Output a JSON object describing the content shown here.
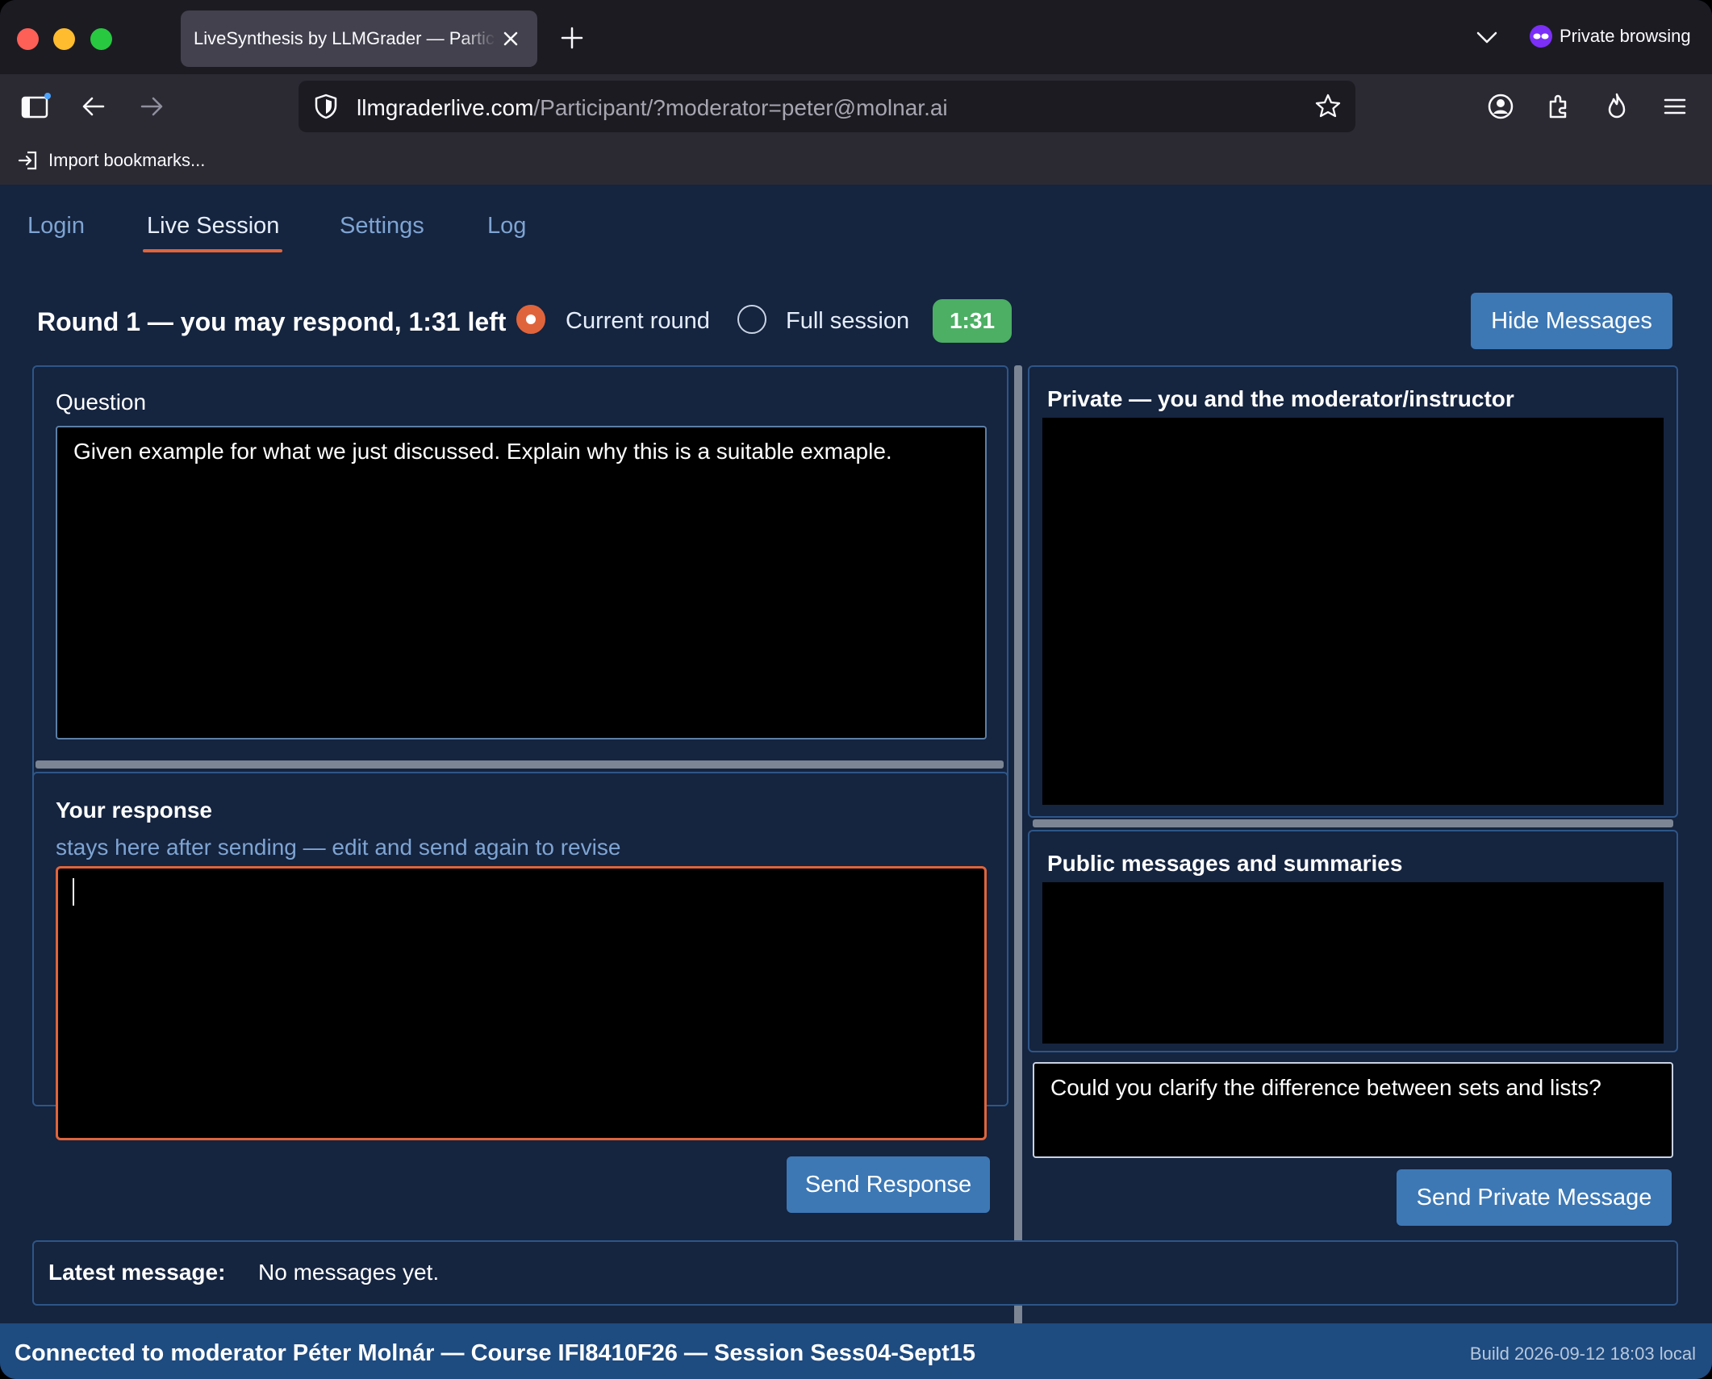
{
  "browser": {
    "tab_title": "LiveSynthesis by LLMGrader — Participant",
    "private_label": "Private browsing",
    "url_host": "llmgraderlive.com",
    "url_path": "/Participant/?moderator=peter@molnar.ai",
    "bookmarks_import": "Import bookmarks..."
  },
  "nav_tabs": [
    {
      "label": "Login",
      "active": false
    },
    {
      "label": "Live Session",
      "active": true
    },
    {
      "label": "Settings",
      "active": false
    },
    {
      "label": "Log",
      "active": false
    }
  ],
  "status": {
    "round_text": "Round 1 — you may respond, 1:31 left",
    "option_current": "Current round",
    "option_full": "Full session",
    "selected_option": "Current round",
    "timer": "1:31",
    "hide_button": "Hide Messages"
  },
  "question": {
    "title": "Question",
    "text": "Given example  for what we just discussed. Explain why this is a suitable exmaple."
  },
  "response": {
    "title": "Your response",
    "hint": "stays here after sending — edit and send again to revise",
    "value": "",
    "send_button": "Send Response"
  },
  "private_panel": {
    "title": "Private — you and the moderator/instructor"
  },
  "public_panel": {
    "title": "Public messages and summaries"
  },
  "private_message": {
    "value": "Could you clarify the difference between sets and lists?",
    "send_button": "Send Private Message"
  },
  "latest": {
    "label": "Latest message:",
    "value": "No messages yet."
  },
  "footer": {
    "connection": "Connected to moderator Péter Molnár — Course IFI8410F26 — Session Sess04-Sept15",
    "build": "Build 2026-09-12 18:03 local"
  },
  "colors": {
    "page_bg": "#15243f",
    "accent_orange": "#e0643b",
    "button_blue": "#3d78b5",
    "timer_green": "#4caf64",
    "footer_blue": "#1e4b80"
  }
}
